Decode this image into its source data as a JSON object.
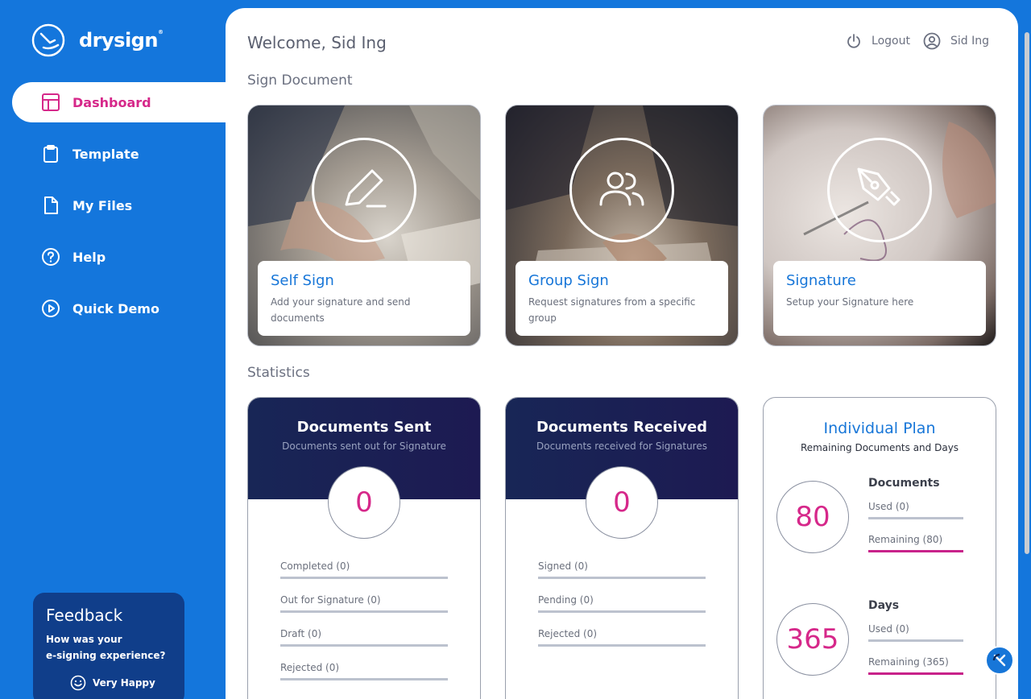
{
  "brand": {
    "name": "drysign",
    "mark": "®"
  },
  "sidebar": {
    "items": [
      {
        "label": "Dashboard",
        "icon": "layout-icon",
        "active": true
      },
      {
        "label": "Template",
        "icon": "clipboard-icon"
      },
      {
        "label": "My Files",
        "icon": "file-icon"
      },
      {
        "label": "Help",
        "icon": "help-circle-icon"
      },
      {
        "label": "Quick Demo",
        "icon": "play-circle-icon"
      }
    ]
  },
  "feedback": {
    "title": "Feedback",
    "line1": "How was your",
    "line2": "e-signing experience?",
    "option": "Very Happy"
  },
  "header": {
    "welcome": "Welcome, Sid Ing",
    "logout": "Logout",
    "user": "Sid Ing"
  },
  "sign": {
    "title": "Sign Document",
    "cards": [
      {
        "title": "Self Sign",
        "desc": "Add your signature and send documents"
      },
      {
        "title": "Group Sign",
        "desc": "Request signatures from a specific group"
      },
      {
        "title": "Signature",
        "desc": "Setup your Signature here"
      }
    ]
  },
  "stats": {
    "title": "Statistics",
    "sent": {
      "title": "Documents Sent",
      "subtitle": "Documents sent out for Signature",
      "count": "0",
      "rows": [
        "Completed (0)",
        "Out for Signature (0)",
        "Draft (0)",
        "Rejected (0)"
      ]
    },
    "received": {
      "title": "Documents Received",
      "subtitle": "Documents received for Signatures",
      "count": "0",
      "rows": [
        "Signed (0)",
        "Pending (0)",
        "Rejected (0)"
      ]
    },
    "plan": {
      "title": "Individual Plan",
      "subtitle": "Remaining Documents and Days",
      "documents": {
        "heading": "Documents",
        "count": "80",
        "used": "Used (0)",
        "remaining": "Remaining (80)"
      },
      "days": {
        "heading": "Days",
        "count": "365",
        "used": "Used (0)",
        "remaining": "Remaining (365)"
      }
    }
  },
  "colors": {
    "primary": "#1476dc",
    "accent": "#d6288a",
    "navy": "#182656"
  }
}
